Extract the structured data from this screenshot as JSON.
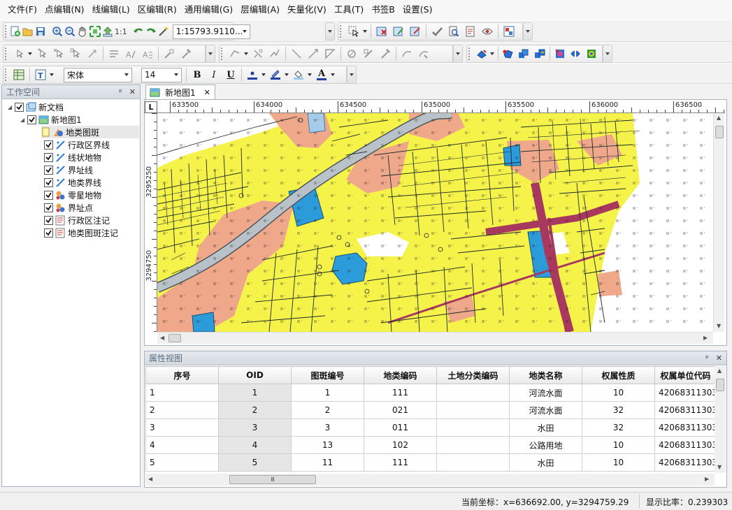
{
  "menu": [
    "文件(F)",
    "点编辑(N)",
    "线编辑(L)",
    "区编辑(R)",
    "通用编辑(G)",
    "层编辑(A)",
    "矢量化(V)",
    "工具(T)",
    "书签B",
    "设置(S)"
  ],
  "toolbar": {
    "scale_value": "1:15793.9110...",
    "fit_label": "1:1",
    "font_name": "宋体",
    "font_size": "14",
    "bold": "B",
    "italic": "I",
    "underline": "U",
    "text_color_label": "A"
  },
  "workspace": {
    "title": "工作空间",
    "pin": "ᵖ",
    "close": "✕",
    "tree": {
      "root": "新文档",
      "map": "新地图1",
      "layers": [
        "地类图斑",
        "行政区界线",
        "线状地物",
        "界址线",
        "地类界线",
        "零星地物",
        "界址点",
        "行政区注记",
        "地类图斑注记"
      ]
    }
  },
  "map": {
    "tab_label": "新地图1",
    "corner_label": "L",
    "ruler_x_labels": [
      "633500",
      "634000",
      "634500",
      "635000",
      "635500",
      "636000",
      "636500"
    ],
    "ruler_y_labels": [
      "3295250",
      "3294750"
    ]
  },
  "attribute": {
    "title": "属性视图",
    "columns": [
      "序号",
      "OID",
      "图斑编号",
      "地类编码",
      "土地分类编码",
      "地类名称",
      "权属性质",
      "权属单位代码"
    ],
    "rows": [
      [
        "1",
        "1",
        "1",
        "111",
        "",
        "河流水面",
        "10",
        "42068311303"
      ],
      [
        "2",
        "2",
        "2",
        "021",
        "",
        "河流水面",
        "32",
        "42068311303"
      ],
      [
        "3",
        "3",
        "3",
        "011",
        "",
        "水田",
        "32",
        "42068311303"
      ],
      [
        "4",
        "4",
        "13",
        "102",
        "",
        "公路用地",
        "10",
        "42068311303"
      ],
      [
        "5",
        "5",
        "11",
        "111",
        "",
        "水田",
        "10",
        "42068311303"
      ]
    ],
    "hscroll_grip": "Ⅲ"
  },
  "status": {
    "coords": "当前坐标：x=636692.00, y=3294759.29",
    "ratio": "显示比率：0.239303"
  },
  "colors": {
    "farmland": "#f5f34a",
    "building": "#f0a88a",
    "water": "#2b9bd9",
    "road": "#a9385f",
    "river": "#b8c2c8"
  }
}
